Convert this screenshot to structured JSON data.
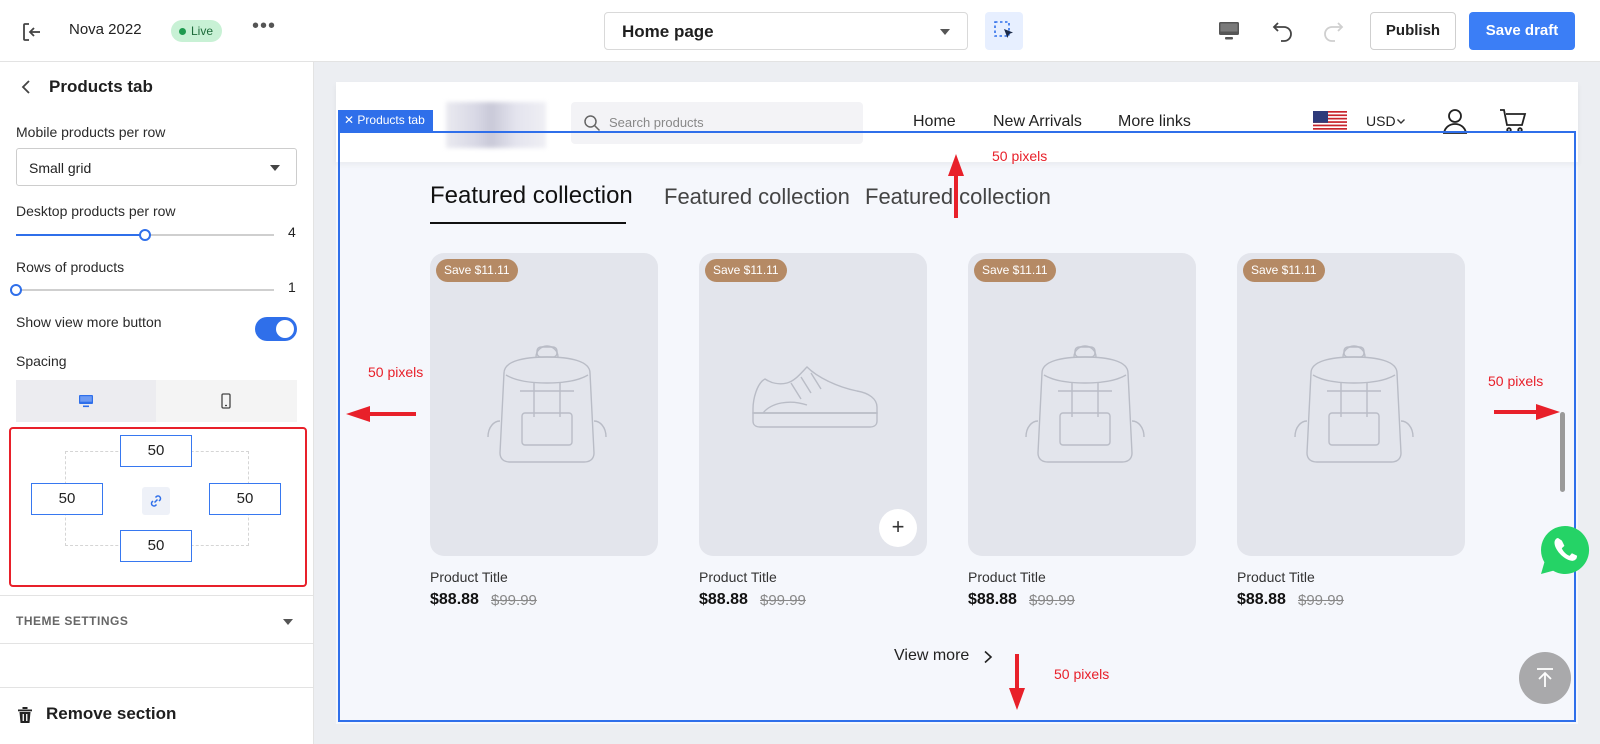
{
  "topbar": {
    "store_name": "Nova 2022",
    "live_label": "Live",
    "more_label": "•••",
    "page_select": "Home page",
    "publish_label": "Publish",
    "save_draft_label": "Save draft",
    "accent_color": "#3b7ef6"
  },
  "sidebar": {
    "title": "Products tab",
    "mobile_per_row_label": "Mobile products per row",
    "mobile_per_row_value": "Small grid",
    "desktop_per_row_label": "Desktop products per row",
    "desktop_per_row_value": "4",
    "desktop_per_row_level": 0.5,
    "rows_label": "Rows of products",
    "rows_value": "1",
    "rows_level": 0,
    "view_more_toggle_label": "Show view more button",
    "view_more_toggle_on": true,
    "spacing_label": "Spacing",
    "spacing": {
      "top": "50",
      "left": "50",
      "right": "50",
      "bottom": "50"
    },
    "theme_settings_label": "THEME SETTINGS",
    "remove_label": "Remove section"
  },
  "preview": {
    "selected_section_tag": "Products tab",
    "search_placeholder": "Search products",
    "nav": [
      "Home",
      "New Arrivals",
      "More links"
    ],
    "currency": "USD",
    "tabs": [
      "Featured collection",
      "Featured collection",
      "Featured collection"
    ],
    "products": [
      {
        "badge": "Save $11.11",
        "image": "backpack-icon",
        "title": "Product Title",
        "price": "$88.88",
        "compare_price": "$99.99"
      },
      {
        "badge": "Save $11.11",
        "image": "sneaker-icon",
        "title": "Product Title",
        "price": "$88.88",
        "compare_price": "$99.99"
      },
      {
        "badge": "Save $11.11",
        "image": "backpack-icon",
        "title": "Product Title",
        "price": "$88.88",
        "compare_price": "$99.99"
      },
      {
        "badge": "Save $11.11",
        "image": "backpack-icon",
        "title": "Product Title",
        "price": "$88.88",
        "compare_price": "$99.99"
      }
    ],
    "view_more_label": "View more",
    "annotations": {
      "top": "50 pixels",
      "left": "50 pixels",
      "right": "50 pixels",
      "bottom": "50 pixels"
    },
    "badge_color": "#b58a65",
    "annotation_color": "#e8202a"
  }
}
